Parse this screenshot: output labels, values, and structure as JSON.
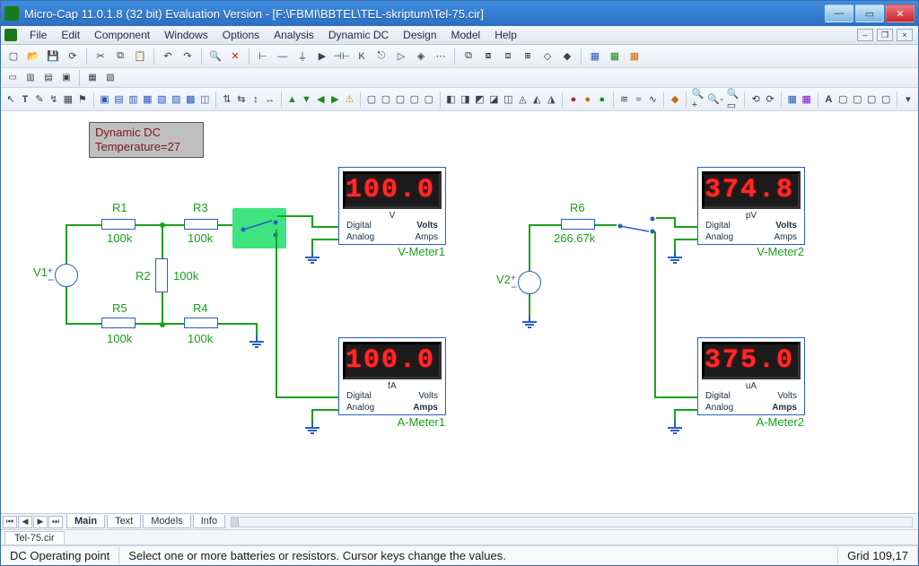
{
  "title": "Micro-Cap 11.0.1.8 (32 bit) Evaluation Version - [F:\\FBMI\\BBTEL\\TEL-skriptum\\Tel-75.cir]",
  "menus": [
    "File",
    "Edit",
    "Component",
    "Windows",
    "Options",
    "Analysis",
    "Dynamic DC",
    "Design",
    "Model",
    "Help"
  ],
  "sim_box": {
    "line1": "Dynamic DC",
    "line2": "Temperature=27"
  },
  "components": {
    "v1": {
      "name": "V1"
    },
    "v2": {
      "name": "V2"
    },
    "r1": {
      "name": "R1",
      "value": "100k"
    },
    "r2": {
      "name": "R2",
      "value": "100k"
    },
    "r3": {
      "name": "R3",
      "value": "100k"
    },
    "r4": {
      "name": "R4",
      "value": "100k"
    },
    "r5": {
      "name": "R5",
      "value": "100k"
    },
    "r6": {
      "name": "R6",
      "value": "266.67k"
    }
  },
  "meters": {
    "vmeter1": {
      "reading": "100.0",
      "unit": "V",
      "label": "V-Meter1",
      "dig_label": "Digital",
      "ana_label": "Analog",
      "volts": "Volts",
      "amps": "Amps"
    },
    "ameter1": {
      "reading": "100.0",
      "unit": "fA",
      "label": "A-Meter1",
      "dig_label": "Digital",
      "ana_label": "Analog",
      "volts": "Volts",
      "amps": "Amps"
    },
    "vmeter2": {
      "reading": "374.8",
      "unit": "pV",
      "label": "V-Meter2",
      "dig_label": "Digital",
      "ana_label": "Analog",
      "volts": "Volts",
      "amps": "Amps"
    },
    "ameter2": {
      "reading": "375.0",
      "unit": "uA",
      "label": "A-Meter2",
      "dig_label": "Digital",
      "ana_label": "Analog",
      "volts": "Volts",
      "amps": "Amps"
    }
  },
  "sheet_tabs": {
    "main": "Main",
    "text": "Text",
    "models": "Models",
    "info": "Info"
  },
  "file_tab": "Tel-75.cir",
  "status": {
    "left": "DC Operating point",
    "hint": "Select one or more batteries or resistors. Cursor keys change the values.",
    "grid": "Grid 109,17"
  }
}
